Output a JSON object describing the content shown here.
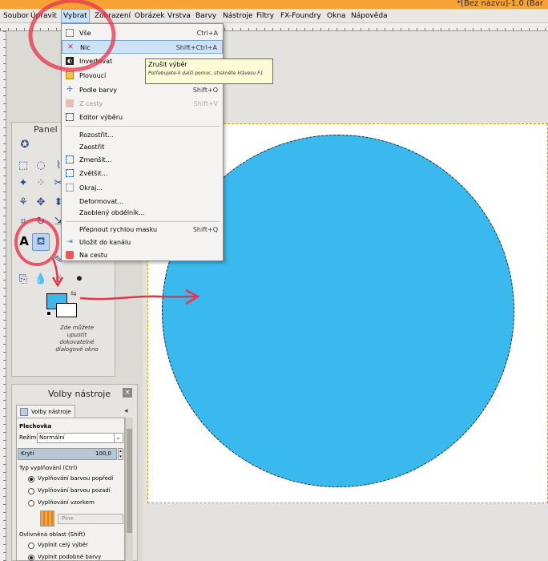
{
  "window": {
    "title": "*[Bez názvu]-1.0 (Bar"
  },
  "menubar": {
    "items": [
      "Soubor",
      "Úpravit",
      "Vybrat",
      "Zobrazení",
      "Obrázek",
      "Vrstva",
      "Barvy",
      "Nástroje",
      "Filtry",
      "FX-Foundry",
      "Okna",
      "Nápověda"
    ]
  },
  "select_menu": {
    "items": [
      {
        "label": "Vše",
        "shortcut": "Ctrl+A"
      },
      {
        "label": "Nic",
        "shortcut": "Shift+Ctrl+A"
      },
      {
        "label": "Invertovat",
        "shortcut": ""
      },
      {
        "label": "Plovoucí",
        "shortcut": ""
      },
      {
        "label": "Podle barvy",
        "shortcut": "Shift+O"
      },
      {
        "label": "Z cesty",
        "shortcut": "Shift+V"
      },
      {
        "label": "Editor výběru",
        "shortcut": ""
      },
      {
        "label": "Rozostřit...",
        "shortcut": ""
      },
      {
        "label": "Zaostřit",
        "shortcut": ""
      },
      {
        "label": "Zmenšit...",
        "shortcut": ""
      },
      {
        "label": "Zvětšit...",
        "shortcut": ""
      },
      {
        "label": "Okraj...",
        "shortcut": ""
      },
      {
        "label": "Deformovat...",
        "shortcut": ""
      },
      {
        "label": "Zaoblený obdélník...",
        "shortcut": ""
      },
      {
        "label": "Přepnout rychlou masku",
        "shortcut": "Shift+Q"
      },
      {
        "label": "Uložit do kanálu",
        "shortcut": ""
      },
      {
        "label": "Na cestu",
        "shortcut": ""
      }
    ]
  },
  "tooltip": {
    "title": "Zrušit výběr",
    "hint": "Potřebujete-li další pomoc, stiskněte klávesu F1"
  },
  "toolbox": {
    "title": "Panel n",
    "dock_hint": "Zde můžete upustit dokovatelné dialogové okno"
  },
  "tool_options": {
    "title": "Volby nástroje",
    "tab_label": "Volby nástroje",
    "tool_name": "Plechovka",
    "mode_label": "Režim:",
    "mode_value": "Normální",
    "opacity_label": "Krytí",
    "opacity_value": "100,0",
    "fill_type_label": "Typ vyplňování  (Ctrl)",
    "fill_fg": "Vyplňování barvou popředí",
    "fill_bg": "Vyplňování barvou pozadí",
    "fill_pattern": "Vyplňování vzorkem",
    "pattern_name": "Pine",
    "affected_area_label": "Ovlivněná oblast  (Shift)",
    "fill_whole": "Vyplnit celý výběr",
    "fill_similar": "Vyplnit podobné barvy"
  },
  "colors": {
    "foreground": "#3ab9ee",
    "background": "#ffffff",
    "titlebar": "#f6a234",
    "annotation": "#e8334a"
  }
}
